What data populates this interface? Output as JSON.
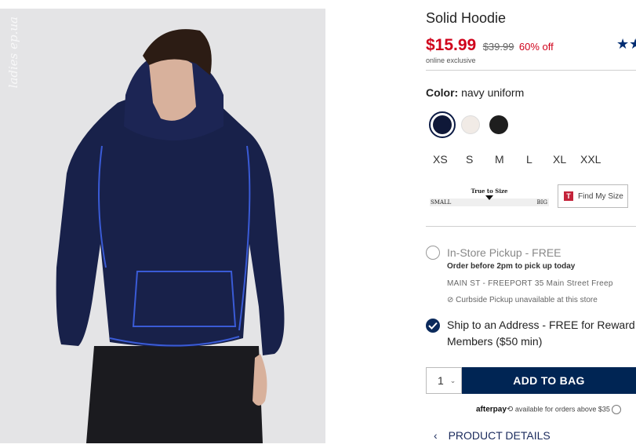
{
  "product": {
    "title": "Solid Hoodie",
    "price_sale": "$15.99",
    "price_original": "$39.99",
    "discount": "60% off",
    "badge": "online exclusive",
    "rating_stars": "★★",
    "watermark": "ladies ep.ua"
  },
  "color": {
    "label": "Color:",
    "selected": "navy uniform",
    "swatches": [
      {
        "name": "navy uniform",
        "hex": "#0f1838"
      },
      {
        "name": "oatmeal",
        "hex": "#f1ebe6"
      },
      {
        "name": "black",
        "hex": "#1e1e1e"
      }
    ]
  },
  "sizes": [
    "XS",
    "S",
    "M",
    "L",
    "XL",
    "XXL"
  ],
  "fit": {
    "title": "True to Size",
    "small": "SMALL",
    "big": "BIG",
    "find_size": "Find My Size",
    "find_icon": "T"
  },
  "pickup": {
    "title": "In-Store Pickup - FREE",
    "subtitle": "Order before 2pm to pick up today",
    "store": "MAIN ST - FREEPORT 35 Main Street  Freep",
    "curbside": "Curbside Pickup unavailable at this store"
  },
  "ship": {
    "line1": "Ship to an Address - FREE for Reward",
    "line2": "Members ($50 min)"
  },
  "cart": {
    "quantity": "1",
    "add_label": "ADD TO BAG"
  },
  "afterpay": {
    "brand": "afterpay",
    "text": "available for orders above $35"
  },
  "details_label": "PRODUCT DETAILS",
  "colors": {
    "sale": "#d0021b",
    "navy": "#002554"
  }
}
